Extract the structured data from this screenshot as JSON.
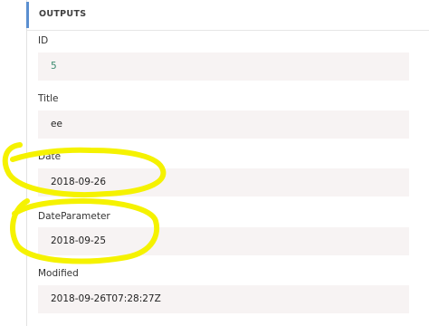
{
  "section": {
    "title": "OUTPUTS"
  },
  "fields": [
    {
      "label": "ID",
      "value": "5"
    },
    {
      "label": "Title",
      "value": "ee"
    },
    {
      "label": "Date",
      "value": "2018-09-26"
    },
    {
      "label": "DateParameter",
      "value": "2018-09-25"
    },
    {
      "label": "Modified",
      "value": "2018-09-26T07:28:27Z"
    }
  ],
  "annotation": {
    "color": "#f5f200"
  }
}
